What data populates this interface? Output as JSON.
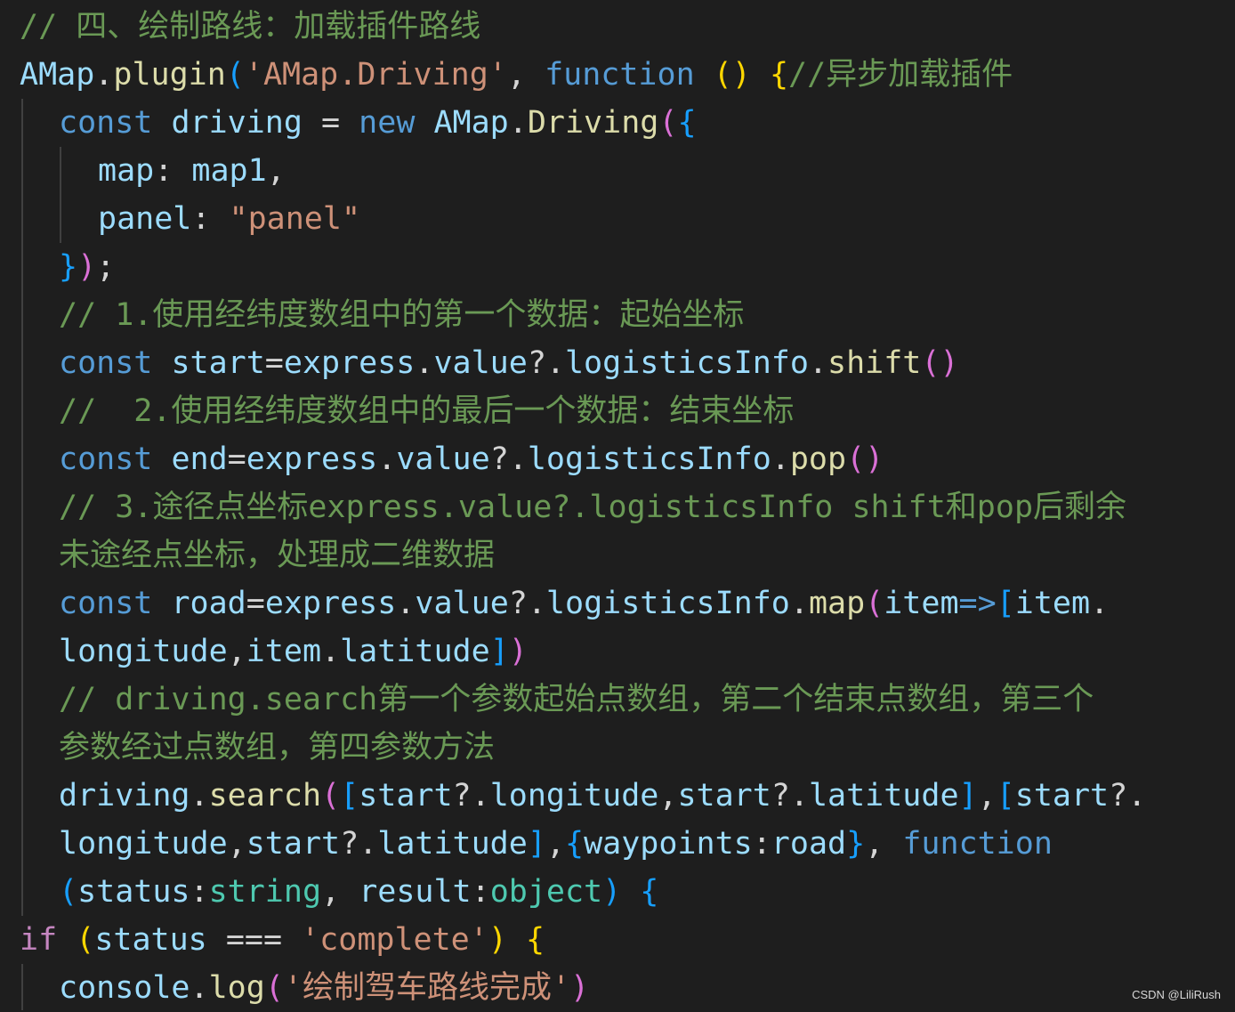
{
  "theme": {
    "background": "#1e1e1e",
    "colors": {
      "plain": "#d4d4d4",
      "comment": "#6a9955",
      "keyword": "#569cd6",
      "control": "#c586c0",
      "string": "#ce9178",
      "function": "#dcdcaa",
      "variable": "#9cdcfe",
      "type": "#4ec9b0",
      "bracket1": "#ffd700",
      "bracket2": "#da70d6",
      "bracket3": "#179fff"
    }
  },
  "editor": {
    "lines": [
      {
        "indent": 0,
        "tokens": [
          {
            "t": "// 四、绘制路线：加载插件路线",
            "c": "comment"
          }
        ]
      },
      {
        "indent": 0,
        "tokens": [
          {
            "t": "AMap",
            "c": "variable"
          },
          {
            "t": ".",
            "c": "plain"
          },
          {
            "t": "plugin",
            "c": "function"
          },
          {
            "t": "(",
            "c": "bracket3"
          },
          {
            "t": "'AMap.Driving'",
            "c": "string"
          },
          {
            "t": ", ",
            "c": "plain"
          },
          {
            "t": "function",
            "c": "keyword"
          },
          {
            "t": " ",
            "c": "plain"
          },
          {
            "t": "()",
            "c": "bracket1"
          },
          {
            "t": " ",
            "c": "plain"
          },
          {
            "t": "{",
            "c": "bracket1"
          },
          {
            "t": "//异步加载插件",
            "c": "comment"
          }
        ]
      },
      {
        "indent": 1,
        "tokens": [
          {
            "t": "const",
            "c": "keyword"
          },
          {
            "t": " ",
            "c": "plain"
          },
          {
            "t": "driving",
            "c": "variable"
          },
          {
            "t": " = ",
            "c": "plain"
          },
          {
            "t": "new",
            "c": "keyword"
          },
          {
            "t": " ",
            "c": "plain"
          },
          {
            "t": "AMap",
            "c": "variable"
          },
          {
            "t": ".",
            "c": "plain"
          },
          {
            "t": "Driving",
            "c": "function"
          },
          {
            "t": "(",
            "c": "bracket2"
          },
          {
            "t": "{",
            "c": "bracket3"
          }
        ]
      },
      {
        "indent": 2,
        "tokens": [
          {
            "t": "map",
            "c": "variable"
          },
          {
            "t": ": ",
            "c": "plain"
          },
          {
            "t": "map1",
            "c": "variable"
          },
          {
            "t": ",",
            "c": "plain"
          }
        ]
      },
      {
        "indent": 2,
        "tokens": [
          {
            "t": "panel",
            "c": "variable"
          },
          {
            "t": ": ",
            "c": "plain"
          },
          {
            "t": "\"panel\"",
            "c": "string"
          }
        ]
      },
      {
        "indent": 1,
        "tokens": [
          {
            "t": "}",
            "c": "bracket3"
          },
          {
            "t": ")",
            "c": "bracket2"
          },
          {
            "t": ";",
            "c": "plain"
          }
        ]
      },
      {
        "indent": 1,
        "tokens": [
          {
            "t": "// 1.使用经纬度数组中的第一个数据：起始坐标",
            "c": "comment"
          }
        ]
      },
      {
        "indent": 1,
        "tokens": [
          {
            "t": "const",
            "c": "keyword"
          },
          {
            "t": " ",
            "c": "plain"
          },
          {
            "t": "start",
            "c": "variable"
          },
          {
            "t": "=",
            "c": "plain"
          },
          {
            "t": "express",
            "c": "variable"
          },
          {
            "t": ".",
            "c": "plain"
          },
          {
            "t": "value",
            "c": "variable"
          },
          {
            "t": "?.",
            "c": "plain"
          },
          {
            "t": "logisticsInfo",
            "c": "variable"
          },
          {
            "t": ".",
            "c": "plain"
          },
          {
            "t": "shift",
            "c": "function"
          },
          {
            "t": "()",
            "c": "bracket2"
          }
        ]
      },
      {
        "indent": 1,
        "tokens": [
          {
            "t": "//  2.使用经纬度数组中的最后一个数据：结束坐标",
            "c": "comment"
          }
        ]
      },
      {
        "indent": 1,
        "tokens": [
          {
            "t": "const",
            "c": "keyword"
          },
          {
            "t": " ",
            "c": "plain"
          },
          {
            "t": "end",
            "c": "variable"
          },
          {
            "t": "=",
            "c": "plain"
          },
          {
            "t": "express",
            "c": "variable"
          },
          {
            "t": ".",
            "c": "plain"
          },
          {
            "t": "value",
            "c": "variable"
          },
          {
            "t": "?.",
            "c": "plain"
          },
          {
            "t": "logisticsInfo",
            "c": "variable"
          },
          {
            "t": ".",
            "c": "plain"
          },
          {
            "t": "pop",
            "c": "function"
          },
          {
            "t": "()",
            "c": "bracket2"
          }
        ]
      },
      {
        "indent": 1,
        "tokens": [
          {
            "t": "// 3.途径点坐标express.value?.logisticsInfo shift和pop后剩余",
            "c": "comment"
          }
        ]
      },
      {
        "indent": 1,
        "tokens": [
          {
            "t": "未途经点坐标，处理成二维数据",
            "c": "comment"
          }
        ]
      },
      {
        "indent": 1,
        "tokens": [
          {
            "t": "const",
            "c": "keyword"
          },
          {
            "t": " ",
            "c": "plain"
          },
          {
            "t": "road",
            "c": "variable"
          },
          {
            "t": "=",
            "c": "plain"
          },
          {
            "t": "express",
            "c": "variable"
          },
          {
            "t": ".",
            "c": "plain"
          },
          {
            "t": "value",
            "c": "variable"
          },
          {
            "t": "?.",
            "c": "plain"
          },
          {
            "t": "logisticsInfo",
            "c": "variable"
          },
          {
            "t": ".",
            "c": "plain"
          },
          {
            "t": "map",
            "c": "function"
          },
          {
            "t": "(",
            "c": "bracket2"
          },
          {
            "t": "item",
            "c": "variable"
          },
          {
            "t": "=>",
            "c": "keyword"
          },
          {
            "t": "[",
            "c": "bracket3"
          },
          {
            "t": "item",
            "c": "variable"
          },
          {
            "t": ".",
            "c": "plain"
          }
        ]
      },
      {
        "indent": 1,
        "tokens": [
          {
            "t": "longitude",
            "c": "variable"
          },
          {
            "t": ",",
            "c": "plain"
          },
          {
            "t": "item",
            "c": "variable"
          },
          {
            "t": ".",
            "c": "plain"
          },
          {
            "t": "latitude",
            "c": "variable"
          },
          {
            "t": "]",
            "c": "bracket3"
          },
          {
            "t": ")",
            "c": "bracket2"
          }
        ]
      },
      {
        "indent": 1,
        "tokens": [
          {
            "t": "// driving.search第一个参数起始点数组，第二个结束点数组，第三个",
            "c": "comment"
          }
        ]
      },
      {
        "indent": 1,
        "tokens": [
          {
            "t": "参数经过点数组，第四参数方法",
            "c": "comment"
          }
        ]
      },
      {
        "indent": 1,
        "tokens": [
          {
            "t": "driving",
            "c": "variable"
          },
          {
            "t": ".",
            "c": "plain"
          },
          {
            "t": "search",
            "c": "function"
          },
          {
            "t": "(",
            "c": "bracket2"
          },
          {
            "t": "[",
            "c": "bracket3"
          },
          {
            "t": "start",
            "c": "variable"
          },
          {
            "t": "?.",
            "c": "plain"
          },
          {
            "t": "longitude",
            "c": "variable"
          },
          {
            "t": ",",
            "c": "plain"
          },
          {
            "t": "start",
            "c": "variable"
          },
          {
            "t": "?.",
            "c": "plain"
          },
          {
            "t": "latitude",
            "c": "variable"
          },
          {
            "t": "]",
            "c": "bracket3"
          },
          {
            "t": ",",
            "c": "plain"
          },
          {
            "t": "[",
            "c": "bracket3"
          },
          {
            "t": "start",
            "c": "variable"
          },
          {
            "t": "?.",
            "c": "plain"
          }
        ]
      },
      {
        "indent": 1,
        "tokens": [
          {
            "t": "longitude",
            "c": "variable"
          },
          {
            "t": ",",
            "c": "plain"
          },
          {
            "t": "start",
            "c": "variable"
          },
          {
            "t": "?.",
            "c": "plain"
          },
          {
            "t": "latitude",
            "c": "variable"
          },
          {
            "t": "]",
            "c": "bracket3"
          },
          {
            "t": ",",
            "c": "plain"
          },
          {
            "t": "{",
            "c": "bracket3"
          },
          {
            "t": "waypoints",
            "c": "variable"
          },
          {
            "t": ":",
            "c": "plain"
          },
          {
            "t": "road",
            "c": "variable"
          },
          {
            "t": "}",
            "c": "bracket3"
          },
          {
            "t": ", ",
            "c": "plain"
          },
          {
            "t": "function",
            "c": "keyword"
          }
        ]
      },
      {
        "indent": 1,
        "tokens": [
          {
            "t": "(",
            "c": "bracket3"
          },
          {
            "t": "status",
            "c": "variable"
          },
          {
            "t": ":",
            "c": "plain"
          },
          {
            "t": "string",
            "c": "type"
          },
          {
            "t": ", ",
            "c": "plain"
          },
          {
            "t": "result",
            "c": "variable"
          },
          {
            "t": ":",
            "c": "plain"
          },
          {
            "t": "object",
            "c": "type"
          },
          {
            "t": ")",
            "c": "bracket3"
          },
          {
            "t": " ",
            "c": "plain"
          },
          {
            "t": "{",
            "c": "bracket3"
          }
        ]
      },
      {
        "indent": 0,
        "tokens": [
          {
            "t": "if",
            "c": "control"
          },
          {
            "t": " ",
            "c": "plain"
          },
          {
            "t": "(",
            "c": "bracket1"
          },
          {
            "t": "status",
            "c": "variable"
          },
          {
            "t": " === ",
            "c": "plain"
          },
          {
            "t": "'complete'",
            "c": "string"
          },
          {
            "t": ")",
            "c": "bracket1"
          },
          {
            "t": " ",
            "c": "plain"
          },
          {
            "t": "{",
            "c": "bracket1"
          }
        ]
      },
      {
        "indent": 1,
        "tokens": [
          {
            "t": "console",
            "c": "variable"
          },
          {
            "t": ".",
            "c": "plain"
          },
          {
            "t": "log",
            "c": "function"
          },
          {
            "t": "(",
            "c": "bracket2"
          },
          {
            "t": "'绘制驾车路线完成'",
            "c": "string"
          },
          {
            "t": ")",
            "c": "bracket2"
          }
        ]
      }
    ]
  },
  "watermark": {
    "text": "CSDN @LiliRush"
  }
}
